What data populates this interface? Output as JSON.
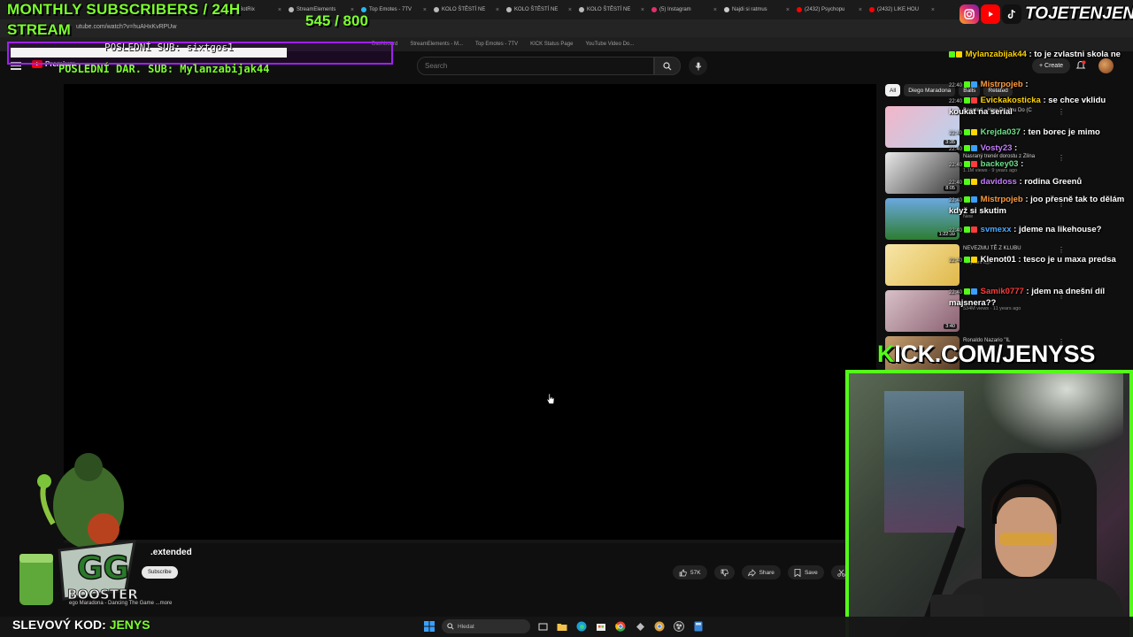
{
  "browser": {
    "tabs": [
      {
        "label": "yalty | BotRix",
        "color": "#888888"
      },
      {
        "label": "StreamElements",
        "color": "#bbbbbb"
      },
      {
        "label": "Top Emotes - 7TV",
        "color": "#29b6f6"
      },
      {
        "label": "KOLO ŠTĚSTÍ NE",
        "color": "#bbbbbb"
      },
      {
        "label": "KOLO ŠTĚSTÍ NE",
        "color": "#bbbbbb"
      },
      {
        "label": "KOLO ŠTĚSTÍ NE",
        "color": "#bbbbbb"
      },
      {
        "label": "(5) Instagram",
        "color": "#e1306c"
      },
      {
        "label": "Najdi si ratmus",
        "color": "#cccccc"
      },
      {
        "label": "(2432) Psychopu",
        "color": "#ff0000"
      },
      {
        "label": "(2432) LIKE HOU",
        "color": "#ff0000"
      }
    ],
    "url": "utube.com/watch?v=huAHxKvRPUw",
    "bookmarks": [
      "Dashboard",
      "StreamElements - M...",
      "Top Emotes - 7TV",
      "KICK Status Page",
      "YouTube Video Do..."
    ]
  },
  "youtube": {
    "logo_text": "Premium",
    "search_placeholder": "Search",
    "create_label": "+ Create",
    "video_title": ".extended",
    "subscribe_label": "Subscribe",
    "likes": "57K",
    "share_label": "Share",
    "save_label": "Save",
    "description": "ego Maradona - Dancing The Game ...more",
    "chips": [
      {
        "label": "All",
        "active": true
      },
      {
        "label": "Diego Maradona",
        "active": false
      },
      {
        "label": "Balls",
        "active": false
      },
      {
        "label": "Related",
        "active": false
      }
    ],
    "recommendations": [
      {
        "title": "Boosted - How Do You Do (C",
        "meta": "",
        "duration": "3:35"
      },
      {
        "title": "Nasraný trenér dorostu z Zlína",
        "meta": "1.1M views · 9 years ago",
        "duration": "8:05"
      },
      {
        "title": "",
        "meta": "New",
        "duration": "1:22:39"
      },
      {
        "title": "NEVEZMU TĚ Z KLUBU",
        "meta": "· 7 years ago",
        "duration": ""
      },
      {
        "title": "",
        "meta": "534M views · 11 years ago",
        "duration": "3:40"
      },
      {
        "title": "Ronaldo Nazario \"IL",
        "meta": "",
        "duration": ""
      }
    ]
  },
  "chat": [
    {
      "time": "",
      "user": "Mylanzabijak44",
      "user_color": "#ffd400",
      "text": ": to je zvlastni skola ne"
    },
    {
      "time": "22:40",
      "user": "Mistrpojeb",
      "user_color": "#ff9a3c",
      "text": ":"
    },
    {
      "time": "22:40",
      "user": "Evickakosticka",
      "user_color": "#ffd400",
      "text": ": se chce vklidu koukat na serial"
    },
    {
      "time": "22:40",
      "user": "Krejda037",
      "user_color": "#6fe08a",
      "text": ": ten borec je mimo"
    },
    {
      "time": "22:40",
      "user": "Vosty23",
      "user_color": "#c77dff",
      "text": ":"
    },
    {
      "time": "22:40",
      "user": "backey03",
      "user_color": "#6fe08a",
      "text": ":"
    },
    {
      "time": "22:40",
      "user": "davidoss",
      "user_color": "#c77dff",
      "text": ": rodina Greenů"
    },
    {
      "time": "22:40",
      "user": "Mistrpojeb",
      "user_color": "#ff9a3c",
      "text": ": joo přesně tak to dělám když si skutim"
    },
    {
      "time": "22:40",
      "user": "svmexx",
      "user_color": "#4aa8ff",
      "text": ": jdeme na likehouse?"
    },
    {
      "time": "22:40",
      "user": "Klenot01",
      "user_color": "#ffffff",
      "text": ": tesco je u maxa predsa"
    },
    {
      "time": "22:40",
      "user": "Samik0777",
      "user_color": "#ff3c3c",
      "text": ": jdem na dnešní díl majsnera??"
    }
  ],
  "overlay": {
    "monthly": "MONTHLY SUBSCRIBERS / 24H",
    "stream": "STREAM",
    "counter": "545 / 800",
    "last_sub": "POSLEDNÍ SUB: sixtgos1",
    "last_dar": "POSLEDNÍ DAR. SUB: Mylanzabijak44",
    "handle": "TOJETENJENYS",
    "kick_k": "K",
    "kick_rest": "ICK.COM/JENYSS",
    "code_label": "SLEVOVÝ KOD:",
    "code_value": "JENYS",
    "accent": "#53fc18"
  },
  "taskbar": {
    "search_placeholder": "Hledat"
  }
}
